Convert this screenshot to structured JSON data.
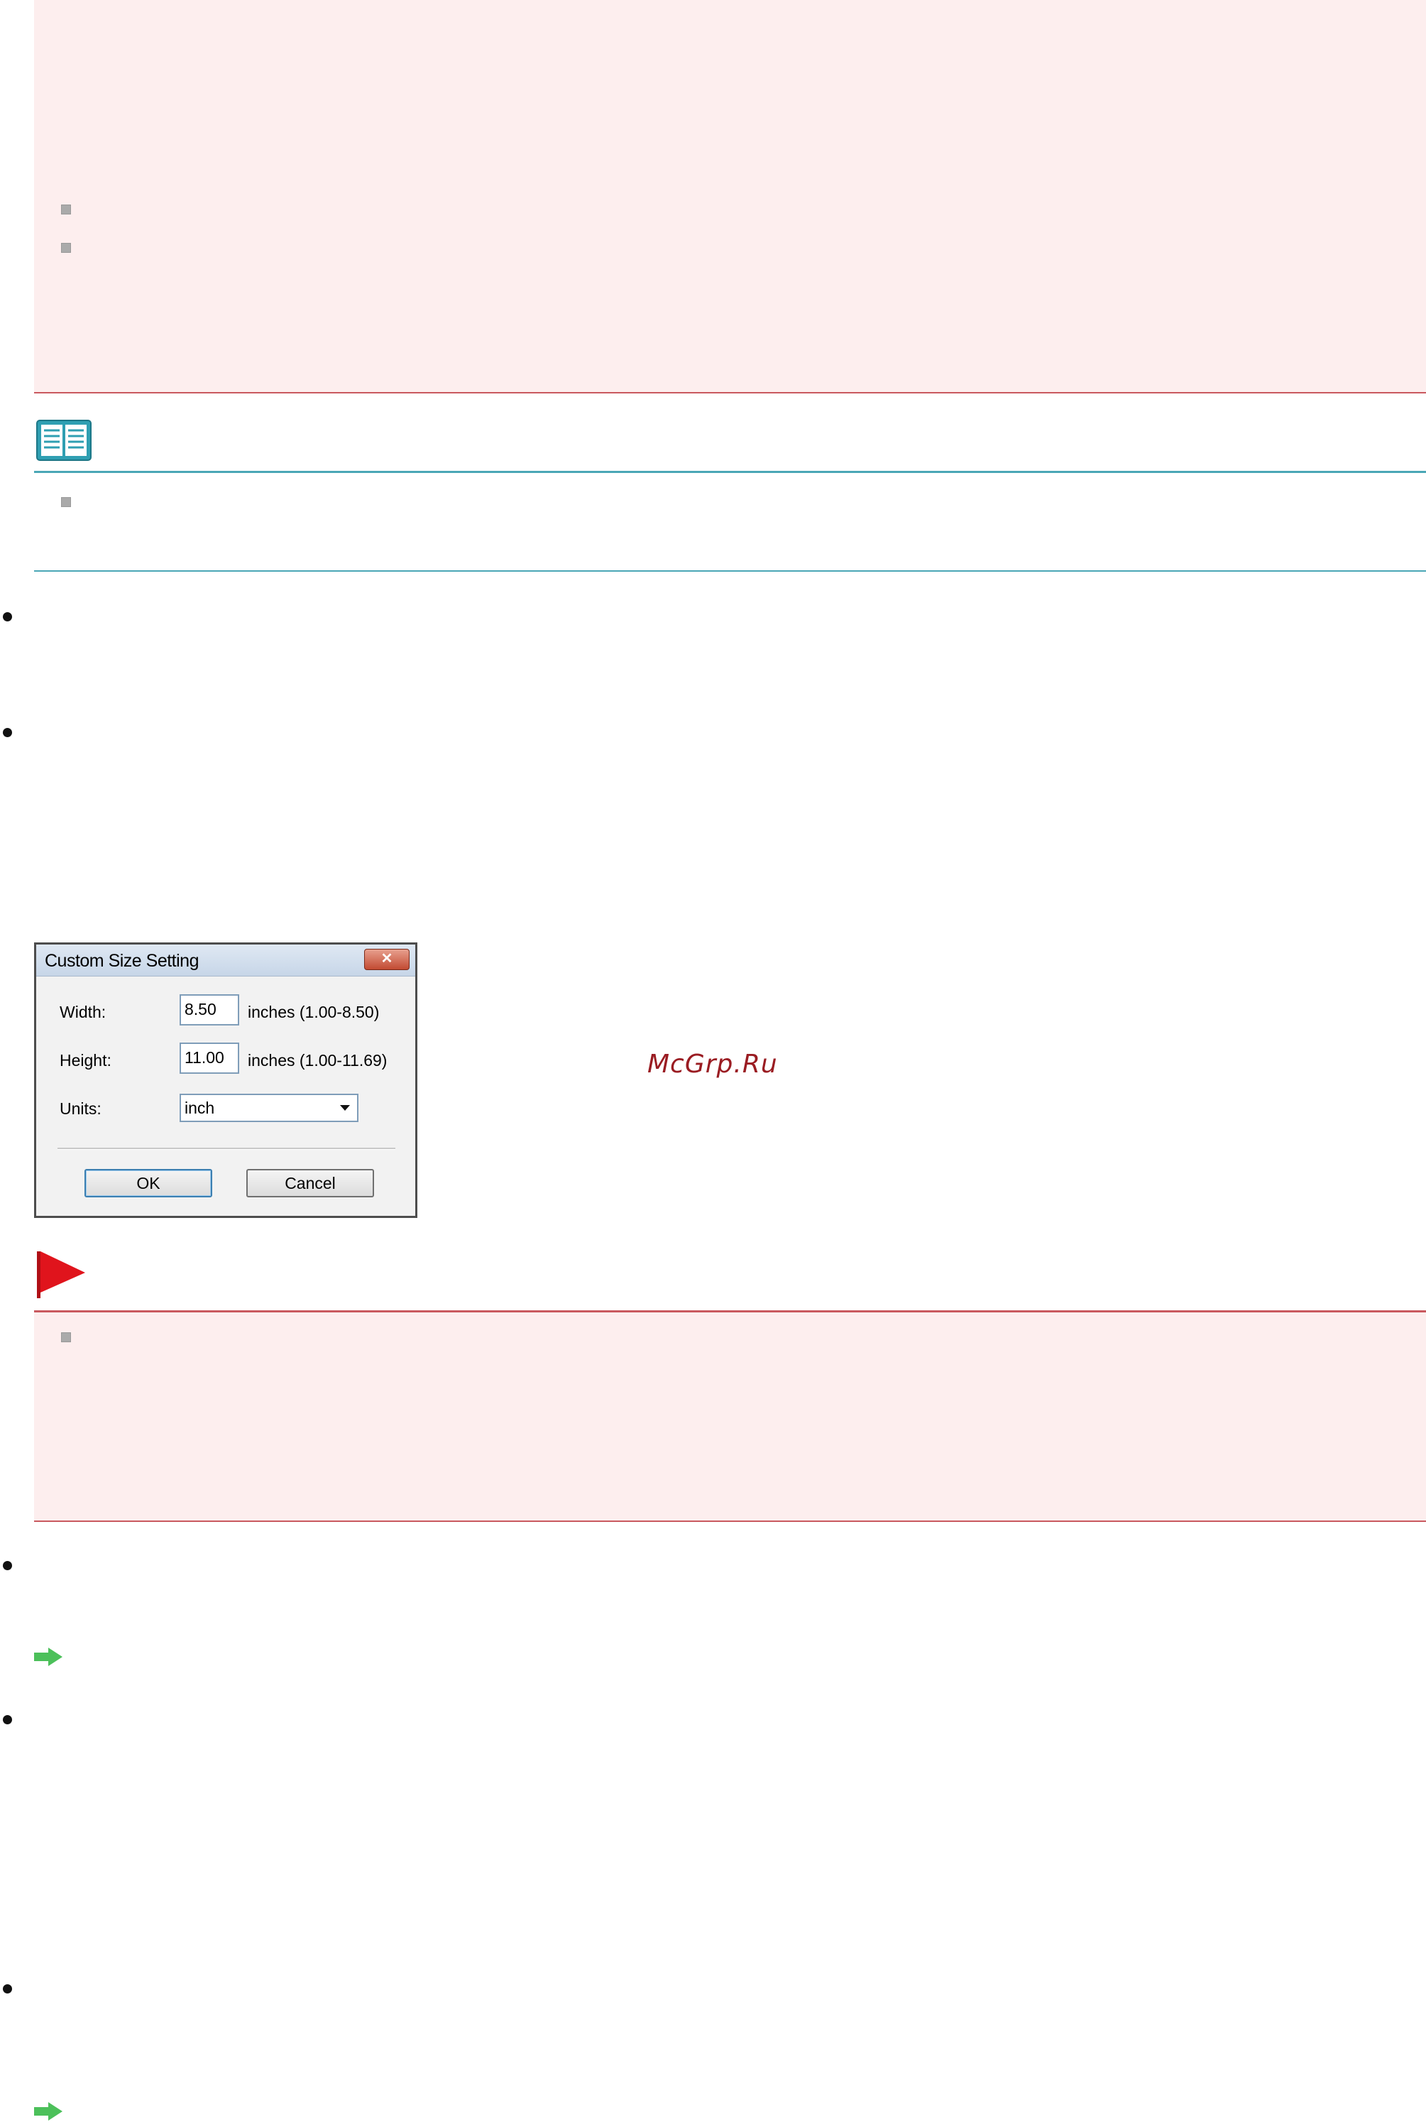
{
  "dialog": {
    "title": "Custom Size Setting",
    "close_label": "✕",
    "width_label": "Width:",
    "width_value": "8.50",
    "width_range": "inches (1.00-8.50)",
    "height_label": "Height:",
    "height_value": "11.00",
    "height_range": "inches (1.00-11.69)",
    "units_label": "Units:",
    "units_value": "inch",
    "ok_label": "OK",
    "cancel_label": "Cancel"
  },
  "watermark": "McGrp.Ru",
  "colors": {
    "important_bg": "#fdeeee",
    "important_border": "#c9595f",
    "note_line": "#4aa7b6",
    "flag": "#e0141c",
    "arrow": "#4cc05a"
  }
}
